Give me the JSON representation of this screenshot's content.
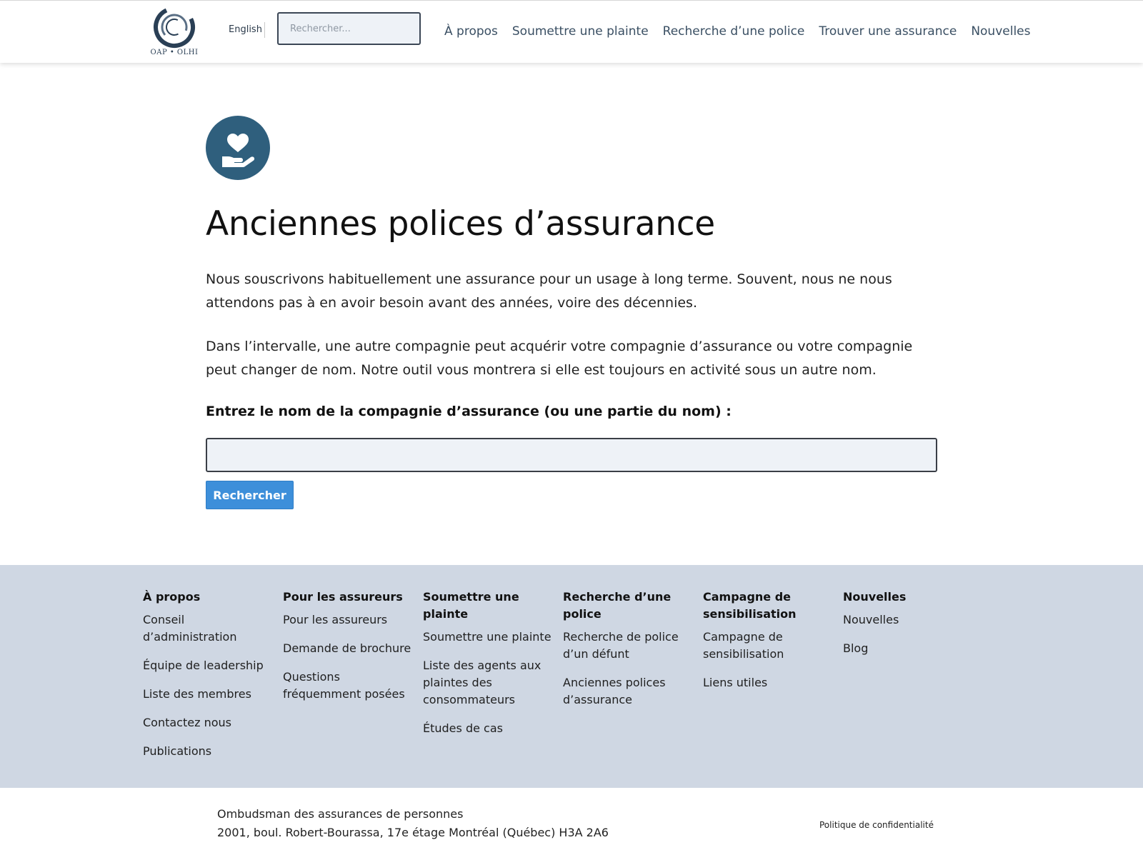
{
  "header": {
    "logo_text": "OAP • OLHI",
    "language_link": "English",
    "search_placeholder": "Rechercher...",
    "nav": [
      "À propos",
      "Soumettre une plainte",
      "Recherche d’une police",
      "Trouver une assurance",
      "Nouvelles"
    ]
  },
  "main": {
    "icon": "hand-heart-icon",
    "title": "Anciennes polices d’assurance",
    "paragraphs": [
      "Nous souscrivons habituellement une assurance pour un usage à long terme. Souvent, nous ne nous attendons pas à en avoir besoin avant des années, voire des décennies.",
      "Dans l’intervalle, une autre compagnie peut acquérir votre compagnie d’assurance ou votre compagnie peut changer de nom. Notre outil vous montrera si elle est toujours en activité sous un autre nom."
    ],
    "field_label": "Entrez le nom de la compagnie d’assurance (ou une partie du nom) :",
    "input_value": "",
    "search_button": "Rechercher"
  },
  "footer": {
    "columns": [
      {
        "heading": "À propos",
        "links": [
          "Conseil d’administration",
          "Équipe de leadership",
          "Liste des membres",
          "Contactez nous",
          "Publications"
        ]
      },
      {
        "heading": "Pour les assureurs",
        "links": [
          "Pour les assureurs",
          "Demande de brochure",
          "Questions fréquemment posées"
        ]
      },
      {
        "heading": "Soumettre une plainte",
        "links": [
          "Soumettre une plainte",
          "Liste des agents aux plaintes des consommateurs",
          "Études de cas"
        ]
      },
      {
        "heading": "Recherche d’une police",
        "links": [
          "Recherche de police d’un défunt",
          "Anciennes polices d’assurance"
        ]
      },
      {
        "heading": "Campagne de sensibilisation",
        "links": [
          "Campagne de sensibilisation",
          "Liens utiles"
        ]
      },
      {
        "heading": "Nouvelles",
        "links": [
          "Nouvelles",
          "Blog"
        ]
      }
    ]
  },
  "bottom": {
    "org_name": "Ombudsman des assurances de personnes",
    "address": "2001, boul. Robert-Bourassa, 17e étage Montréal (Québec) H3A 2A6",
    "privacy_link": "Politique de confidentialité"
  },
  "colors": {
    "accent_button": "#3d8fda",
    "icon_circle": "#2f5f7d",
    "footer_bg": "#cfd7e3",
    "nav_text": "#3a4f63"
  }
}
